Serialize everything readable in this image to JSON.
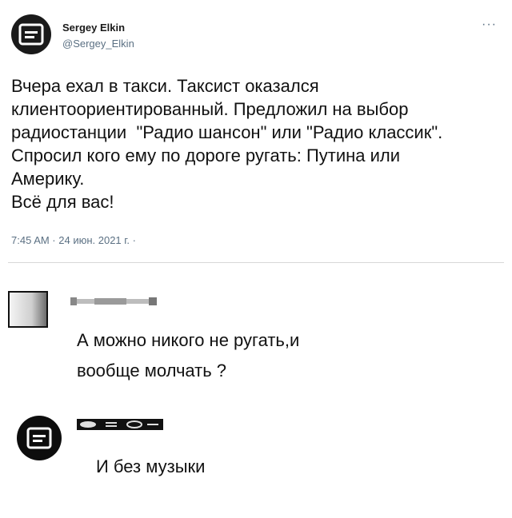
{
  "tweet": {
    "author_name": "Sergey Elkin",
    "author_handle": "@Sergey_Elkin",
    "more_icon": "more-dots-icon",
    "text_lines": [
      "Вчера ехал в такси. Таксист оказался",
      "клиентоориентированный. Предложил на выбор",
      "радиостанции  \"Радио шансон\" или \"Радио классик\".",
      "Спросил кого ему по дороге ругать: Путина или",
      "Америку.",
      "Всё для вас!"
    ],
    "meta": "7:45 AM · 24 июн. 2021 г. ·"
  },
  "comments": [
    {
      "text_lines": [
        "А можно никого не ругать,и",
        "вообще молчать ?"
      ]
    },
    {
      "text_lines": [
        "И без музыки"
      ]
    }
  ]
}
